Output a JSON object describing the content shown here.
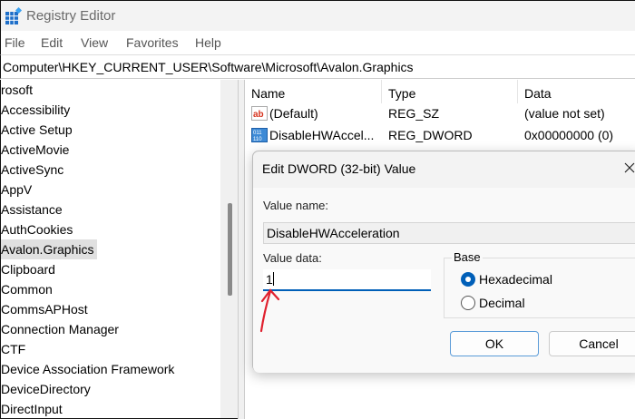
{
  "window": {
    "title": "Registry Editor",
    "icon": "registry-editor-icon"
  },
  "menu": [
    "File",
    "Edit",
    "View",
    "Favorites",
    "Help"
  ],
  "address": "Computer\\HKEY_CURRENT_USER\\Software\\Microsoft\\Avalon.Graphics",
  "tree": {
    "items": [
      "rosoft",
      "Accessibility",
      "Active Setup",
      "ActiveMovie",
      "ActiveSync",
      "AppV",
      "Assistance",
      "AuthCookies",
      "Avalon.Graphics",
      "Clipboard",
      "Common",
      "CommsAPHost",
      "Connection Manager",
      "CTF",
      "Device Association Framework",
      "DeviceDirectory",
      "DirectInput"
    ],
    "selected": "Avalon.Graphics"
  },
  "list": {
    "columns": [
      "Name",
      "Type",
      "Data"
    ],
    "rows": [
      {
        "name": "(Default)",
        "type": "REG_SZ",
        "data": "(value not set)",
        "icon": "string-value-icon"
      },
      {
        "name": "DisableHWAccel...",
        "type": "REG_DWORD",
        "data": "0x00000000 (0)",
        "icon": "dword-value-icon"
      }
    ]
  },
  "dialog": {
    "title": "Edit DWORD (32-bit) Value",
    "value_name_label": "Value name:",
    "value_name": "DisableHWAcceleration",
    "value_data_label": "Value data:",
    "value_data": "1",
    "base_label": "Base",
    "hex_label": "Hexadecimal",
    "dec_label": "Decimal",
    "selected_base": "Hexadecimal",
    "ok": "OK",
    "cancel": "Cancel"
  },
  "colors": {
    "accent": "#005fb8",
    "annotation_arrow": "#e0202e"
  }
}
